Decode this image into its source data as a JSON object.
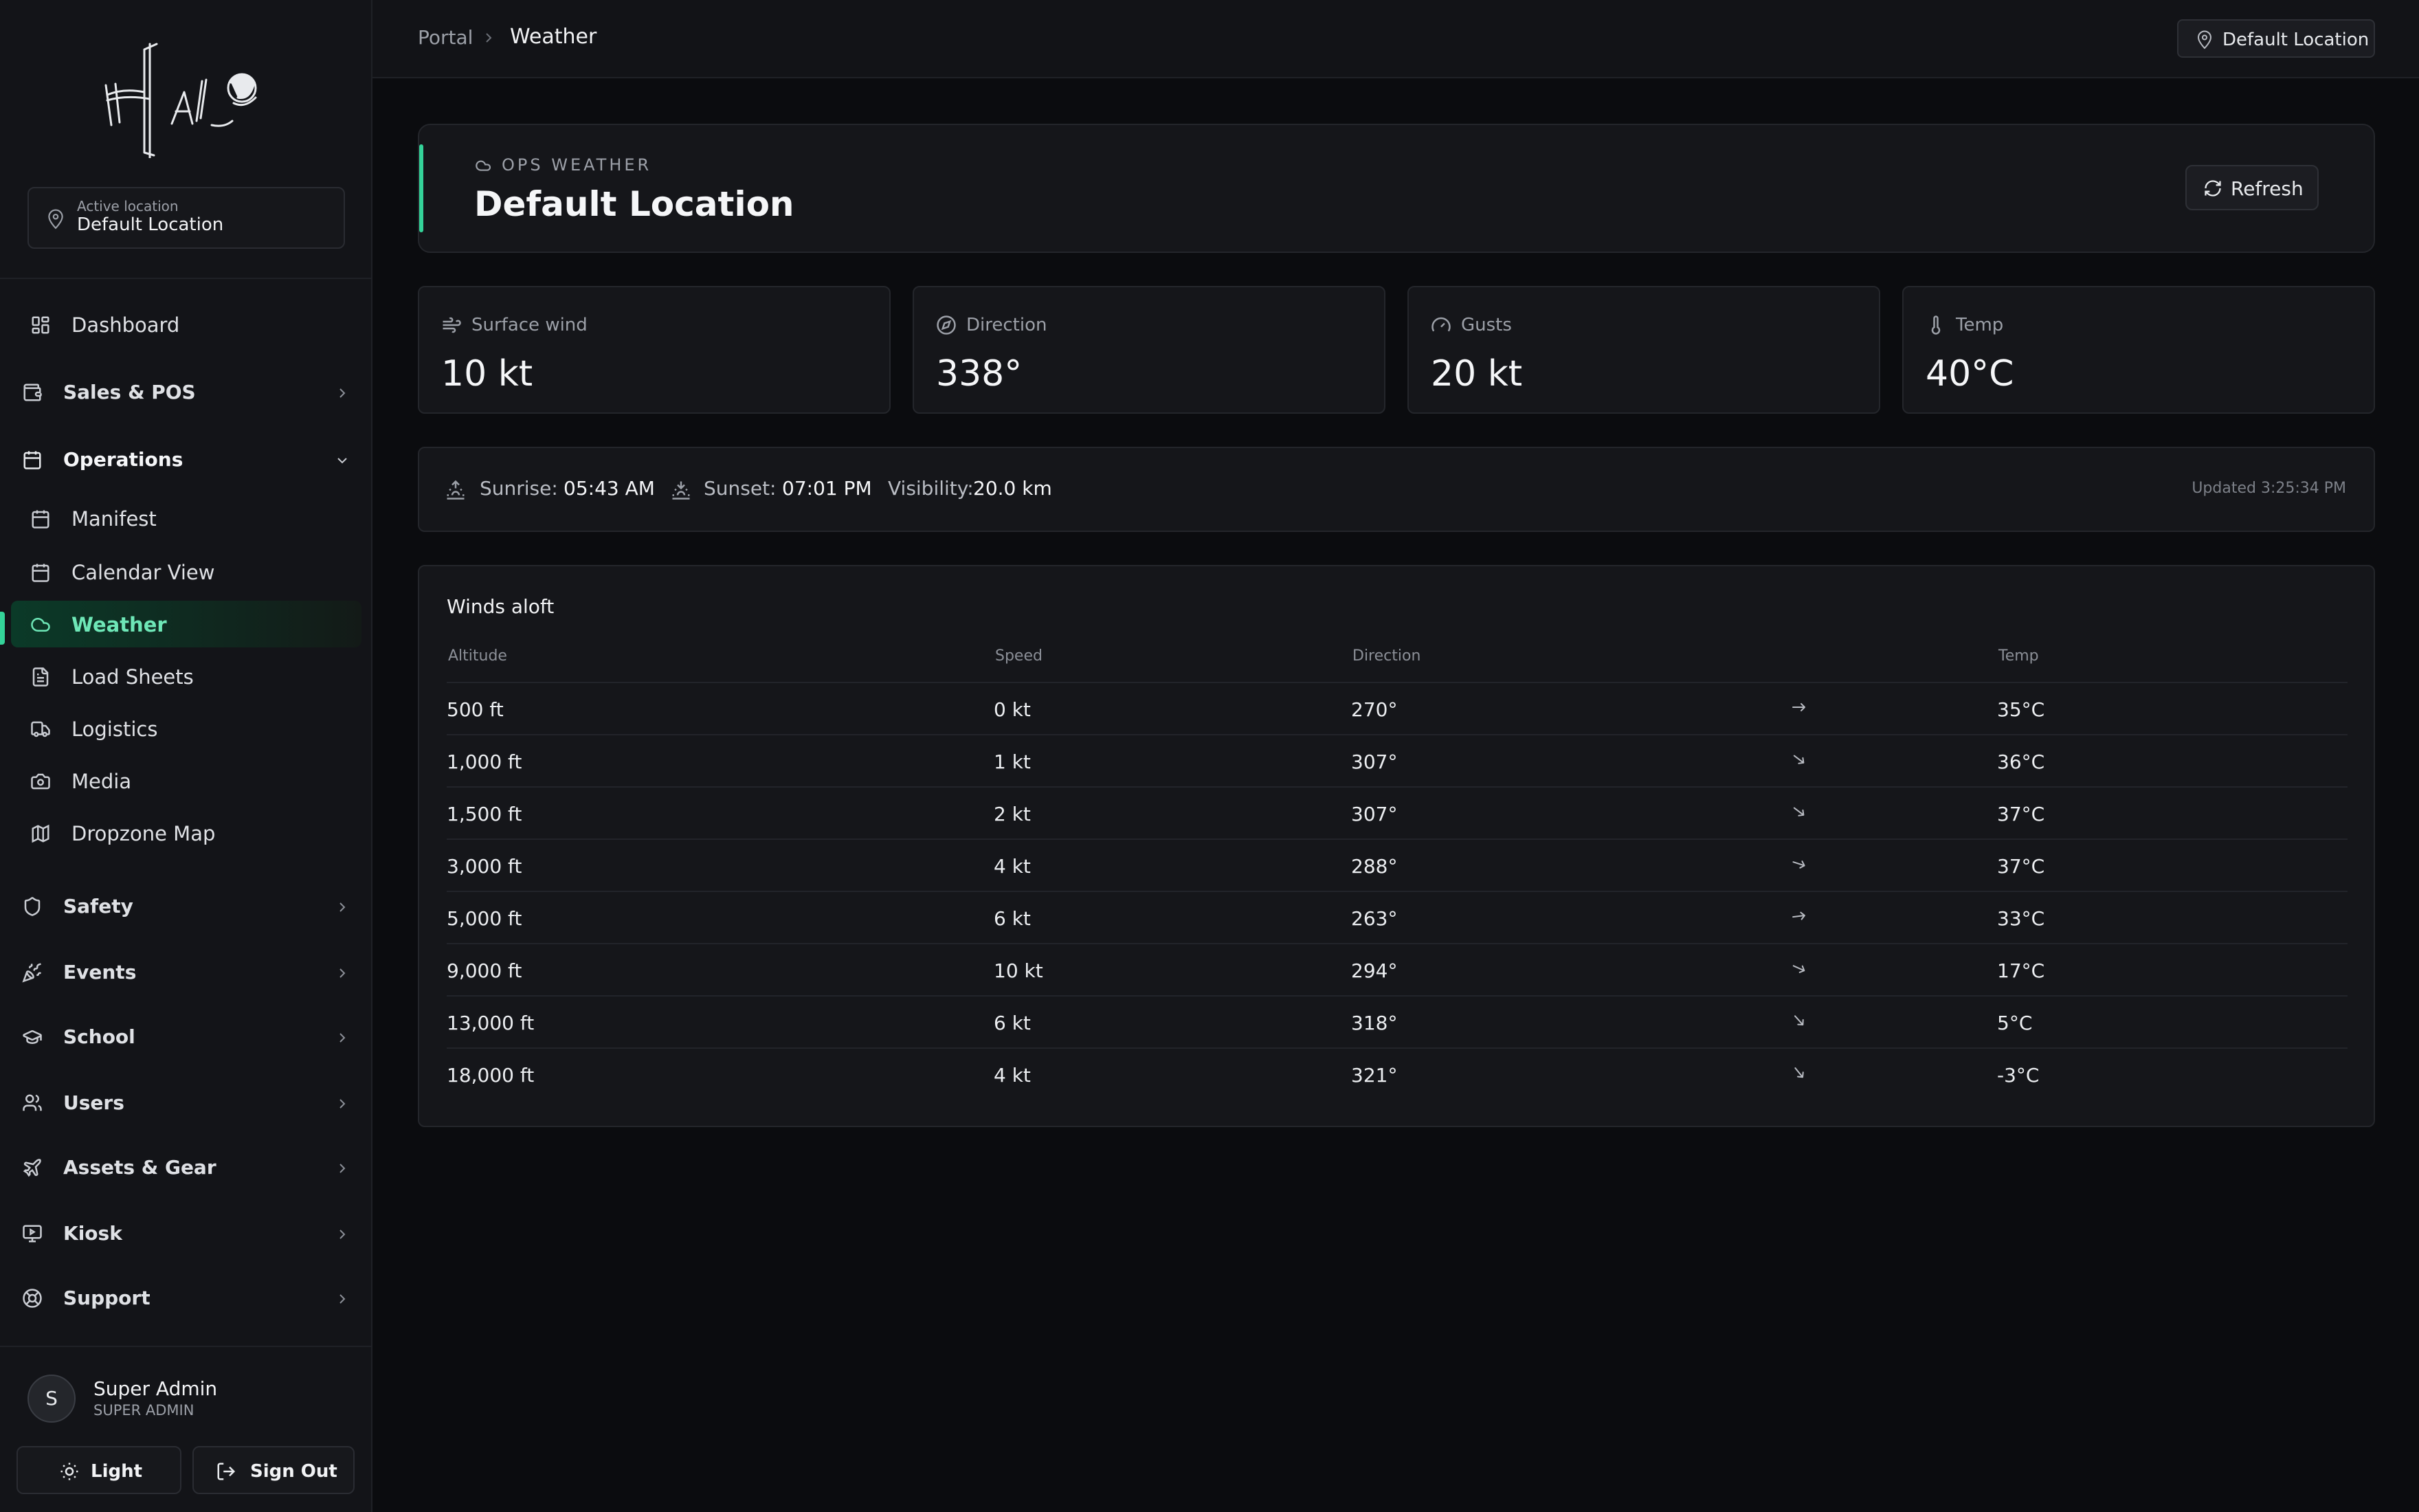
{
  "sidebar": {
    "active_location": {
      "caption": "Active location",
      "value": "Default Location"
    },
    "items": [
      {
        "label": "Dashboard"
      },
      {
        "label": "Sales & POS"
      },
      {
        "label": "Operations"
      },
      {
        "label": "Manifest"
      },
      {
        "label": "Calendar View"
      },
      {
        "label": "Weather"
      },
      {
        "label": "Load Sheets"
      },
      {
        "label": "Logistics"
      },
      {
        "label": "Media"
      },
      {
        "label": "Dropzone Map"
      },
      {
        "label": "Safety"
      },
      {
        "label": "Events"
      },
      {
        "label": "School"
      },
      {
        "label": "Users"
      },
      {
        "label": "Assets & Gear"
      },
      {
        "label": "Kiosk"
      },
      {
        "label": "Support"
      }
    ],
    "user": {
      "name": "Super Admin",
      "role": "SUPER ADMIN",
      "initial": "S"
    },
    "theme_button": "Light",
    "signout_button": "Sign Out"
  },
  "topbar": {
    "breadcrumb": [
      "Portal",
      "Weather"
    ],
    "location_button": "Default Location"
  },
  "header": {
    "eyebrow": "OPS WEATHER",
    "title": "Default Location",
    "refresh_label": "Refresh"
  },
  "stats": [
    {
      "label": "Surface wind",
      "value": "10 kt",
      "icon": "wind-icon"
    },
    {
      "label": "Direction",
      "value": "338°",
      "icon": "compass-icon"
    },
    {
      "label": "Gusts",
      "value": "20 kt",
      "icon": "gauge-icon"
    },
    {
      "label": "Temp",
      "value": "40°C",
      "icon": "thermometer-icon"
    }
  ],
  "sun": {
    "sunrise_label": "Sunrise:",
    "sunrise": "05:43 AM",
    "sunset_label": "Sunset:",
    "sunset": "07:01 PM",
    "visibility_label": "Visibility:",
    "visibility": "20.0 km",
    "updated": "Updated 3:25:34 PM"
  },
  "winds_aloft": {
    "title": "Winds aloft",
    "columns": [
      "Altitude",
      "Speed",
      "Direction",
      "Temp"
    ],
    "rows": [
      {
        "altitude": "500 ft",
        "speed": "0 kt",
        "direction": "270°",
        "dir_deg": 270,
        "temp": "35°C"
      },
      {
        "altitude": "1,000 ft",
        "speed": "1 kt",
        "direction": "307°",
        "dir_deg": 307,
        "temp": "36°C"
      },
      {
        "altitude": "1,500 ft",
        "speed": "2 kt",
        "direction": "307°",
        "dir_deg": 307,
        "temp": "37°C"
      },
      {
        "altitude": "3,000 ft",
        "speed": "4 kt",
        "direction": "288°",
        "dir_deg": 288,
        "temp": "37°C"
      },
      {
        "altitude": "5,000 ft",
        "speed": "6 kt",
        "direction": "263°",
        "dir_deg": 263,
        "temp": "33°C"
      },
      {
        "altitude": "9,000 ft",
        "speed": "10 kt",
        "direction": "294°",
        "dir_deg": 294,
        "temp": "17°C"
      },
      {
        "altitude": "13,000 ft",
        "speed": "6 kt",
        "direction": "318°",
        "dir_deg": 318,
        "temp": "5°C"
      },
      {
        "altitude": "18,000 ft",
        "speed": "4 kt",
        "direction": "321°",
        "dir_deg": 321,
        "temp": "-3°C"
      }
    ]
  },
  "colors": {
    "accent": "#34d399",
    "background": "#0b0c0f",
    "panel": "#15161a"
  }
}
